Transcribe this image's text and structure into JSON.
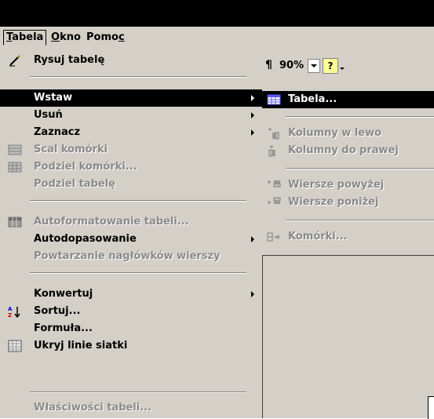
{
  "menubar": {
    "tabela": "Tabela",
    "okno": "Okno",
    "pomoc": "Pomoc"
  },
  "toolbar": {
    "zoom": "90%"
  },
  "menu": {
    "items": [
      {
        "label": "Rysuj tabelę"
      },
      {
        "label": "Wstaw"
      },
      {
        "label": "Usuń"
      },
      {
        "label": "Zaznacz"
      },
      {
        "label": "Scal komórki"
      },
      {
        "label": "Podziel komórki..."
      },
      {
        "label": "Podziel tabelę"
      },
      {
        "label": "Autoformatowanie tabeli..."
      },
      {
        "label": "Autodopasowanie"
      },
      {
        "label": "Powtarzanie nagłówków wierszy"
      },
      {
        "label": "Konwertuj"
      },
      {
        "label": "Sortuj..."
      },
      {
        "label": "Formuła..."
      },
      {
        "label": "Ukryj linie siatki"
      },
      {
        "label": "Właściwości tabeli..."
      }
    ]
  },
  "submenu": {
    "items": [
      {
        "label": "Tabela..."
      },
      {
        "label": "Kolumny w lewo"
      },
      {
        "label": "Kolumny do prawej"
      },
      {
        "label": "Wiersze powyżej"
      },
      {
        "label": "Wiersze poniżej"
      },
      {
        "label": "Komórki..."
      }
    ]
  }
}
